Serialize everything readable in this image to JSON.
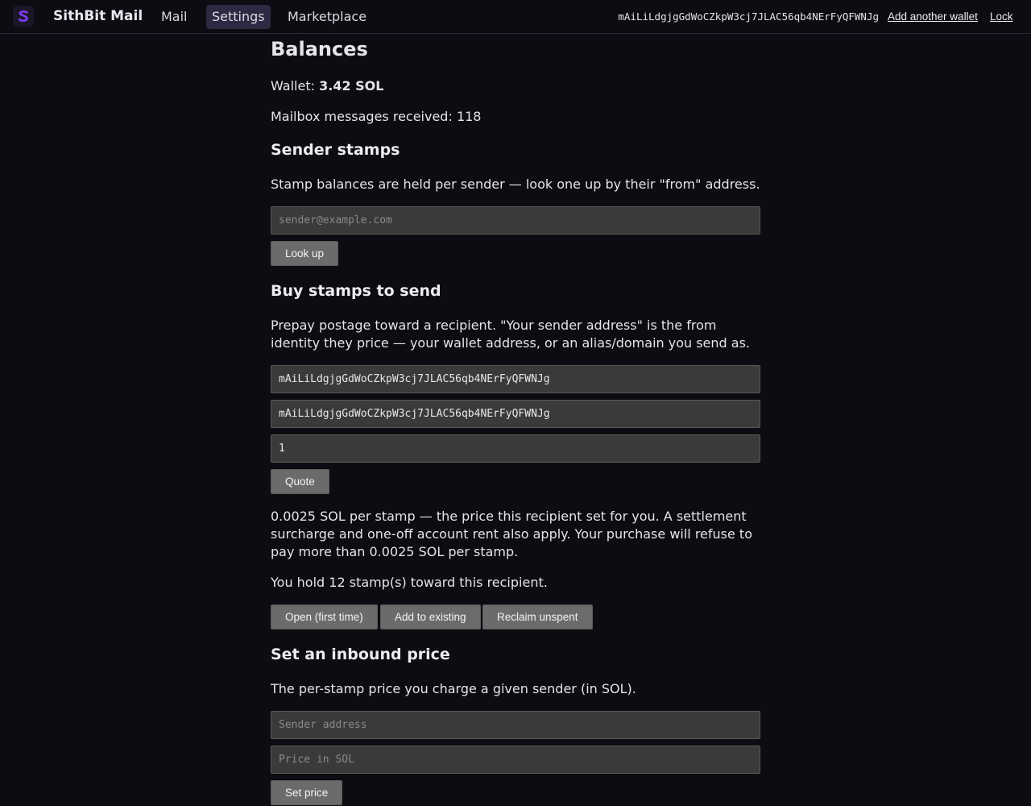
{
  "app": {
    "logo_letter": "S",
    "name": "SithBit Mail",
    "accent": "#7c3aed"
  },
  "nav": [
    {
      "label": "Mail"
    },
    {
      "label": "Settings",
      "active": true
    },
    {
      "label": "Marketplace"
    }
  ],
  "header": {
    "wallet_address": "mAiLiLdgjgGdWoCZkpW3cj7JLAC56qb4NErFyQFWNJg",
    "add_wallet_label": "Add another wallet",
    "lock_label": "Lock"
  },
  "balances": {
    "title": "Balances",
    "wallet_prefix": "Wallet: ",
    "wallet_value": "3.42 SOL",
    "mailbox_text": "Mailbox messages received: 118"
  },
  "sender_stamps": {
    "title": "Sender stamps",
    "description": "Stamp balances are held per sender — look one up by their \"from\" address.",
    "input_placeholder": "sender@example.com",
    "lookup_label": "Look up"
  },
  "buy_stamps": {
    "title": "Buy stamps to send",
    "description": "Prepay postage toward a recipient. \"Your sender address\" is the from identity they price — your wallet address, or an alias/domain you send as.",
    "recipient_value": "mAiLiLdgjgGdWoCZkpW3cj7JLAC56qb4NErFyQFWNJg",
    "sender_value": "mAiLiLdgjgGdWoCZkpW3cj7JLAC56qb4NErFyQFWNJg",
    "quantity_value": "1",
    "quote_label": "Quote",
    "quote_text": "0.0025 SOL per stamp — the price this recipient set for you. A settlement surcharge and one-off account rent also apply. Your purchase will refuse to pay more than 0.0025 SOL per stamp.",
    "holdings_text": "You hold 12 stamp(s) toward this recipient.",
    "open_label": "Open (first time)",
    "add_label": "Add to existing",
    "reclaim_label": "Reclaim unspent"
  },
  "inbound_price": {
    "title": "Set an inbound price",
    "description": "The per-stamp price you charge a given sender (in SOL).",
    "sender_placeholder": "Sender address",
    "price_placeholder": "Price in SOL",
    "set_label": "Set price"
  }
}
